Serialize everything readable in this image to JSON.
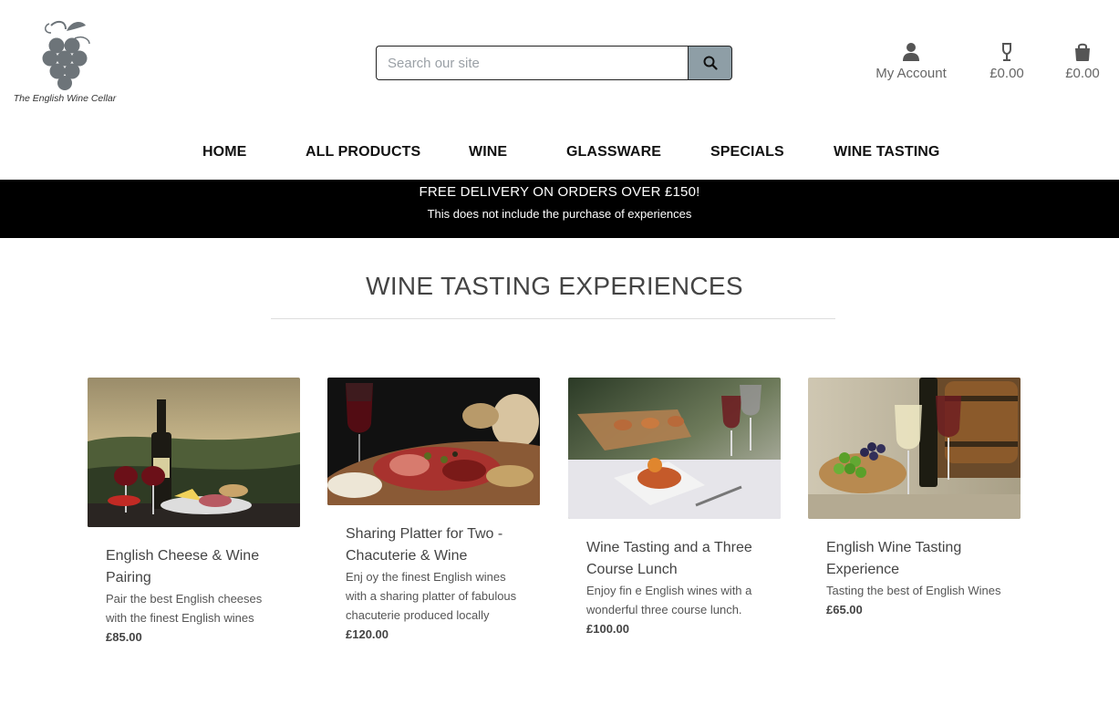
{
  "brand": {
    "logo_text": "The English Wine Cellar"
  },
  "search": {
    "placeholder": "Search our site"
  },
  "top_links": [
    {
      "label": "My Account",
      "icon": "user-icon"
    },
    {
      "label": "£0.00",
      "icon": "wine-glass-icon"
    },
    {
      "label": "£0.00",
      "icon": "shopping-bag-icon"
    }
  ],
  "nav": [
    "HOME",
    "ALL PRODUCTS",
    "WINE",
    "GLASSWARE",
    "SPECIALS",
    "WINE TASTING"
  ],
  "banner": {
    "line1": "FREE DELIVERY ON ORDERS OVER £150!",
    "line2": "This does not include the purchase of experiences"
  },
  "page_title": "WINE TASTING EXPERIENCES",
  "products": [
    {
      "title": "English Cheese & Wine Pairing",
      "description": "Pair the best English cheeses with the finest English wines",
      "price": "£85.00"
    },
    {
      "title": "Sharing Platter for Two - Chacuterie & Wine",
      "description": "Enj oy the finest English wines with a sharing platter of fabulous chacuterie produced locally",
      "price": "£120.00"
    },
    {
      "title": "Wine Tasting and a Three Course Lunch",
      "description": "Enjoy fin e English wines with a wonderful three course lunch.",
      "price": "£100.00"
    },
    {
      "title": "English Wine Tasting Experience",
      "description": "Tasting the best of English Wines",
      "price": "£65.00"
    }
  ],
  "colors": {
    "accent": "#8e9ea6",
    "banner_bg": "#000000",
    "logo": "#6d7479"
  }
}
